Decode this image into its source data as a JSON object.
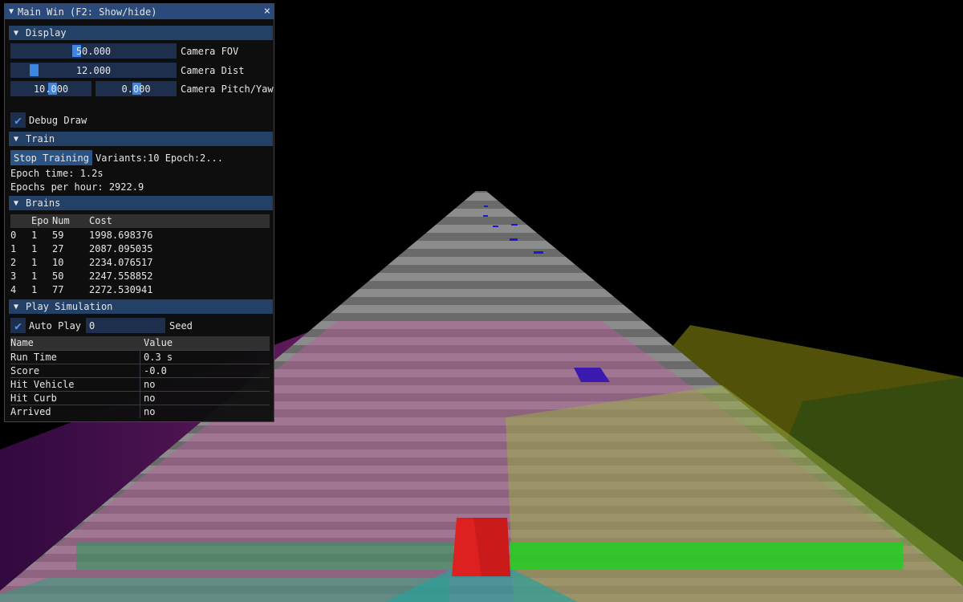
{
  "window": {
    "title": "Main Win (F2: Show/hide)"
  },
  "display": {
    "header": "Display",
    "fov": {
      "value": "50.000",
      "label": "Camera FOV"
    },
    "dist": {
      "value": "12.000",
      "label": "Camera Dist"
    },
    "pitch": {
      "value": "10.000"
    },
    "yaw": {
      "value": "0.000"
    },
    "pitch_yaw_label": "Camera Pitch/Yaw",
    "debug_draw_label": "Debug Draw"
  },
  "train": {
    "header": "Train",
    "stop_label": "Stop Training",
    "status": "Variants:10 Epoch:2...",
    "epoch_time": "Epoch time: 1.2s",
    "epochs_per_hour": "Epochs per hour: 2922.9"
  },
  "brains": {
    "header": "Brains",
    "columns": [
      "",
      "Epo",
      "Num",
      "Cost"
    ],
    "rows": [
      [
        "0",
        "1",
        "59",
        "1998.698376"
      ],
      [
        "1",
        "1",
        "27",
        "2087.095035"
      ],
      [
        "2",
        "1",
        "10",
        "2234.076517"
      ],
      [
        "3",
        "1",
        "50",
        "2247.558852"
      ],
      [
        "4",
        "1",
        "77",
        "2272.530941"
      ]
    ]
  },
  "play": {
    "header": "Play Simulation",
    "auto_play_label": "Auto Play",
    "seed_value": "0",
    "seed_label": "Seed",
    "columns": [
      "Name",
      "Value"
    ],
    "rows": [
      [
        "Run Time",
        "0.3 s"
      ],
      [
        "Score",
        "-0.0"
      ],
      [
        "Hit Vehicle",
        "no"
      ],
      [
        "Hit Curb",
        "no"
      ],
      [
        "Arrived",
        "no"
      ]
    ]
  },
  "icons": {
    "collapse": "▼",
    "close": "×",
    "check": "✔"
  },
  "colors": {
    "title_bar": "#294a7a",
    "header": "#234066",
    "frame": "#1d2f4d",
    "accent": "#3d85e0"
  }
}
